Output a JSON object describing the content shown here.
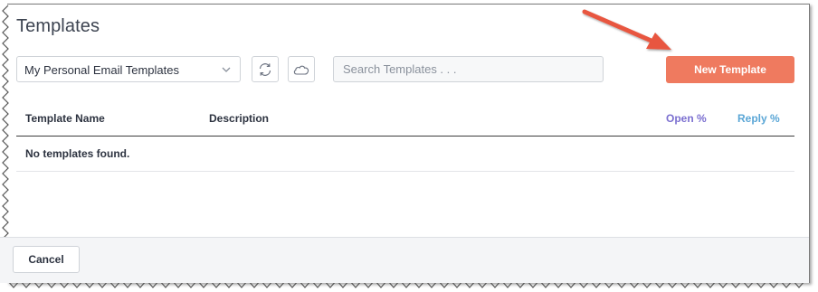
{
  "dialog": {
    "title": "Templates"
  },
  "toolbar": {
    "folder_select_value": "My Personal Email Templates",
    "refresh_icon": "refresh-icon",
    "salesforce_icon": "cloud-icon",
    "search_placeholder": "Search Templates . . .",
    "new_template_label": "New Template"
  },
  "table": {
    "columns": [
      "Template Name",
      "Description",
      "Open %",
      "Reply %"
    ],
    "empty_message": "No templates found."
  },
  "footer": {
    "cancel_label": "Cancel"
  },
  "colors": {
    "accent": "#ef7a5f",
    "open_pct": "#7b6fd0",
    "reply_pct": "#5aa6d6",
    "annotation_arrow": "#e8563f"
  }
}
